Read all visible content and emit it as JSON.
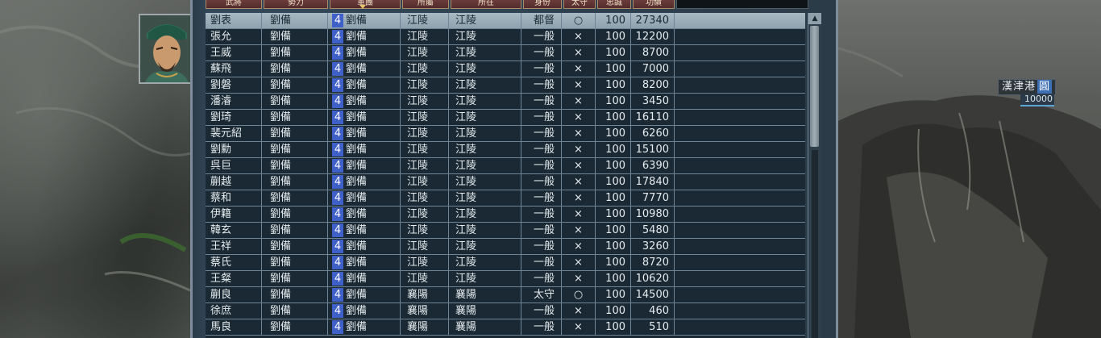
{
  "header": {
    "columns": [
      {
        "label": "武將",
        "style": "normal"
      },
      {
        "label": "勢力",
        "style": "normal"
      },
      {
        "label": "軍團",
        "style": "normal"
      },
      {
        "label": "所屬",
        "style": "normal"
      },
      {
        "label": "所在",
        "style": "normal"
      },
      {
        "label": "身份",
        "style": "normal"
      },
      {
        "label": "太守",
        "style": "normal"
      },
      {
        "label": "忠誠",
        "style": "normal"
      },
      {
        "label": "功績",
        "style": "normal"
      },
      {
        "label": "",
        "style": "dark"
      }
    ]
  },
  "map": {
    "location_label": "漢津港",
    "location_tag": "圓",
    "troops": "10000"
  },
  "rows": [
    {
      "name": "劉表",
      "lord": "劉備",
      "army_no": "4",
      "army": "劉備",
      "belong": "江陵",
      "location": "江陵",
      "rank": "都督",
      "governor": "○",
      "loyalty": "100",
      "merit": "27340"
    },
    {
      "name": "張允",
      "lord": "劉備",
      "army_no": "4",
      "army": "劉備",
      "belong": "江陵",
      "location": "江陵",
      "rank": "一般",
      "governor": "×",
      "loyalty": "100",
      "merit": "12200"
    },
    {
      "name": "王威",
      "lord": "劉備",
      "army_no": "4",
      "army": "劉備",
      "belong": "江陵",
      "location": "江陵",
      "rank": "一般",
      "governor": "×",
      "loyalty": "100",
      "merit": "8700"
    },
    {
      "name": "蘇飛",
      "lord": "劉備",
      "army_no": "4",
      "army": "劉備",
      "belong": "江陵",
      "location": "江陵",
      "rank": "一般",
      "governor": "×",
      "loyalty": "100",
      "merit": "7000"
    },
    {
      "name": "劉磐",
      "lord": "劉備",
      "army_no": "4",
      "army": "劉備",
      "belong": "江陵",
      "location": "江陵",
      "rank": "一般",
      "governor": "×",
      "loyalty": "100",
      "merit": "8200"
    },
    {
      "name": "潘濬",
      "lord": "劉備",
      "army_no": "4",
      "army": "劉備",
      "belong": "江陵",
      "location": "江陵",
      "rank": "一般",
      "governor": "×",
      "loyalty": "100",
      "merit": "3450"
    },
    {
      "name": "劉琦",
      "lord": "劉備",
      "army_no": "4",
      "army": "劉備",
      "belong": "江陵",
      "location": "江陵",
      "rank": "一般",
      "governor": "×",
      "loyalty": "100",
      "merit": "16110"
    },
    {
      "name": "裴元紹",
      "lord": "劉備",
      "army_no": "4",
      "army": "劉備",
      "belong": "江陵",
      "location": "江陵",
      "rank": "一般",
      "governor": "×",
      "loyalty": "100",
      "merit": "6260"
    },
    {
      "name": "劉勳",
      "lord": "劉備",
      "army_no": "4",
      "army": "劉備",
      "belong": "江陵",
      "location": "江陵",
      "rank": "一般",
      "governor": "×",
      "loyalty": "100",
      "merit": "15100"
    },
    {
      "name": "呉巨",
      "lord": "劉備",
      "army_no": "4",
      "army": "劉備",
      "belong": "江陵",
      "location": "江陵",
      "rank": "一般",
      "governor": "×",
      "loyalty": "100",
      "merit": "6390"
    },
    {
      "name": "蒯越",
      "lord": "劉備",
      "army_no": "4",
      "army": "劉備",
      "belong": "江陵",
      "location": "江陵",
      "rank": "一般",
      "governor": "×",
      "loyalty": "100",
      "merit": "17840"
    },
    {
      "name": "蔡和",
      "lord": "劉備",
      "army_no": "4",
      "army": "劉備",
      "belong": "江陵",
      "location": "江陵",
      "rank": "一般",
      "governor": "×",
      "loyalty": "100",
      "merit": "7770"
    },
    {
      "name": "伊籍",
      "lord": "劉備",
      "army_no": "4",
      "army": "劉備",
      "belong": "江陵",
      "location": "江陵",
      "rank": "一般",
      "governor": "×",
      "loyalty": "100",
      "merit": "10980"
    },
    {
      "name": "韓玄",
      "lord": "劉備",
      "army_no": "4",
      "army": "劉備",
      "belong": "江陵",
      "location": "江陵",
      "rank": "一般",
      "governor": "×",
      "loyalty": "100",
      "merit": "5480"
    },
    {
      "name": "王祥",
      "lord": "劉備",
      "army_no": "4",
      "army": "劉備",
      "belong": "江陵",
      "location": "江陵",
      "rank": "一般",
      "governor": "×",
      "loyalty": "100",
      "merit": "3260"
    },
    {
      "name": "蔡氏",
      "lord": "劉備",
      "army_no": "4",
      "army": "劉備",
      "belong": "江陵",
      "location": "江陵",
      "rank": "一般",
      "governor": "×",
      "loyalty": "100",
      "merit": "8720"
    },
    {
      "name": "王粲",
      "lord": "劉備",
      "army_no": "4",
      "army": "劉備",
      "belong": "江陵",
      "location": "江陵",
      "rank": "一般",
      "governor": "×",
      "loyalty": "100",
      "merit": "10620"
    },
    {
      "name": "蒯良",
      "lord": "劉備",
      "army_no": "4",
      "army": "劉備",
      "belong": "襄陽",
      "location": "襄陽",
      "rank": "太守",
      "governor": "○",
      "loyalty": "100",
      "merit": "14500"
    },
    {
      "name": "徐庶",
      "lord": "劉備",
      "army_no": "4",
      "army": "劉備",
      "belong": "襄陽",
      "location": "襄陽",
      "rank": "一般",
      "governor": "×",
      "loyalty": "100",
      "merit": "460"
    },
    {
      "name": "馬良",
      "lord": "劉備",
      "army_no": "4",
      "army": "劉備",
      "belong": "襄陽",
      "location": "襄陽",
      "rank": "一般",
      "governor": "×",
      "loyalty": "100",
      "merit": "510"
    }
  ],
  "selected_row": 0
}
